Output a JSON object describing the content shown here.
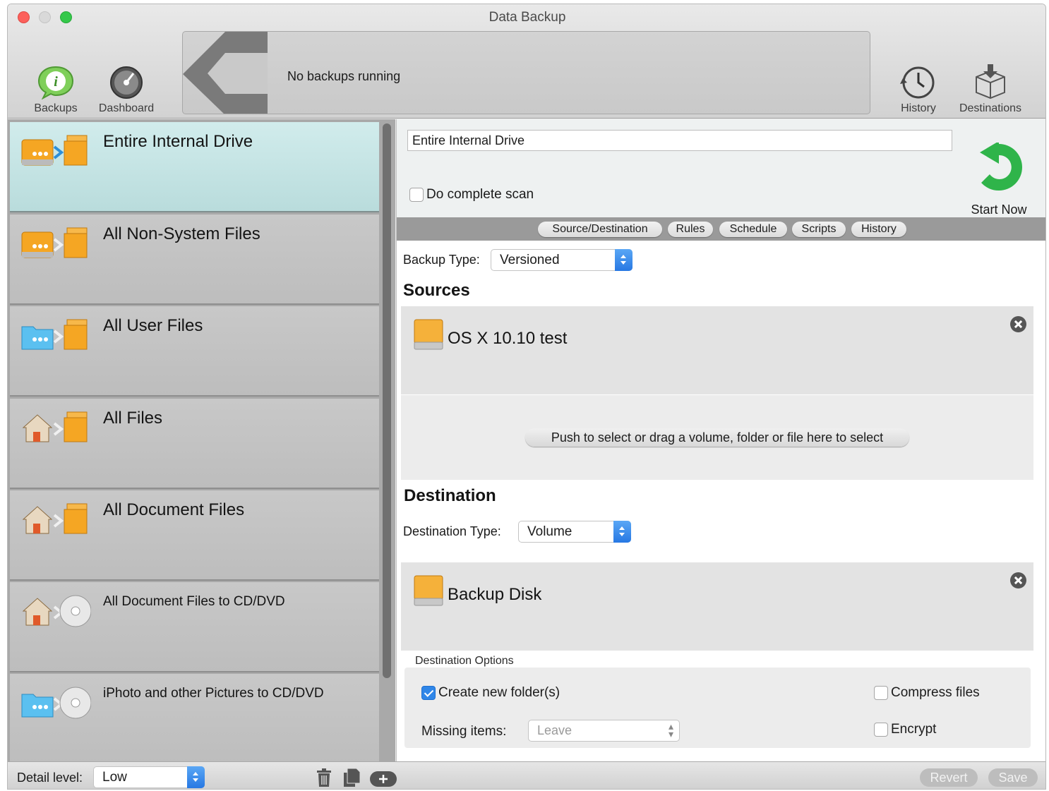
{
  "window": {
    "title": "Data Backup"
  },
  "toolbar": {
    "backups_label": "Backups",
    "dashboard_label": "Dashboard",
    "status_text": "No backups running",
    "history_label": "History",
    "destinations_label": "Destinations"
  },
  "sidebar": {
    "items": [
      {
        "name": "Entire Internal Drive",
        "icon": "drive-to-files-icon",
        "selected": true
      },
      {
        "name": "All Non-System Files",
        "icon": "drive-to-files-icon"
      },
      {
        "name": "All User Files",
        "icon": "user-folder-to-files-icon"
      },
      {
        "name": "All Files",
        "icon": "home-to-files-icon"
      },
      {
        "name": "All Document Files",
        "icon": "home-to-files-icon"
      },
      {
        "name": "All Document Files to CD/DVD",
        "icon": "home-to-disc-icon"
      },
      {
        "name": "iPhoto and other Pictures to CD/DVD",
        "icon": "folder-to-disc-icon"
      }
    ]
  },
  "detail": {
    "backup_name": "Entire Internal Drive",
    "complete_scan_label": "Do complete scan",
    "complete_scan_checked": false,
    "start_now_label": "Start Now",
    "tabs": [
      "Source/Destination",
      "Rules",
      "Schedule",
      "Scripts",
      "History"
    ],
    "backup_type_label": "Backup Type:",
    "backup_type_value": "Versioned",
    "sources_title": "Sources",
    "source_volume": "OS X 10.10 test",
    "push_select_label": "Push to select or drag a volume, folder or file here to select",
    "destination_title": "Destination",
    "destination_type_label": "Destination Type:",
    "destination_type_value": "Volume",
    "destination_volume": "Backup Disk",
    "dest_options_title": "Destination Options",
    "create_folders_label": "Create new folder(s)",
    "create_folders_checked": true,
    "compress_label": "Compress files",
    "compress_checked": false,
    "missing_items_label": "Missing items:",
    "missing_items_value": "Leave",
    "encrypt_label": "Encrypt",
    "encrypt_checked": false
  },
  "bottom": {
    "detail_level_label": "Detail level:",
    "detail_level_value": "Low",
    "revert_label": "Revert",
    "save_label": "Save"
  },
  "colors": {
    "accent_blue": "#2f86e8",
    "start_green": "#2fb44a",
    "selected_row": "#c6e6e6"
  }
}
